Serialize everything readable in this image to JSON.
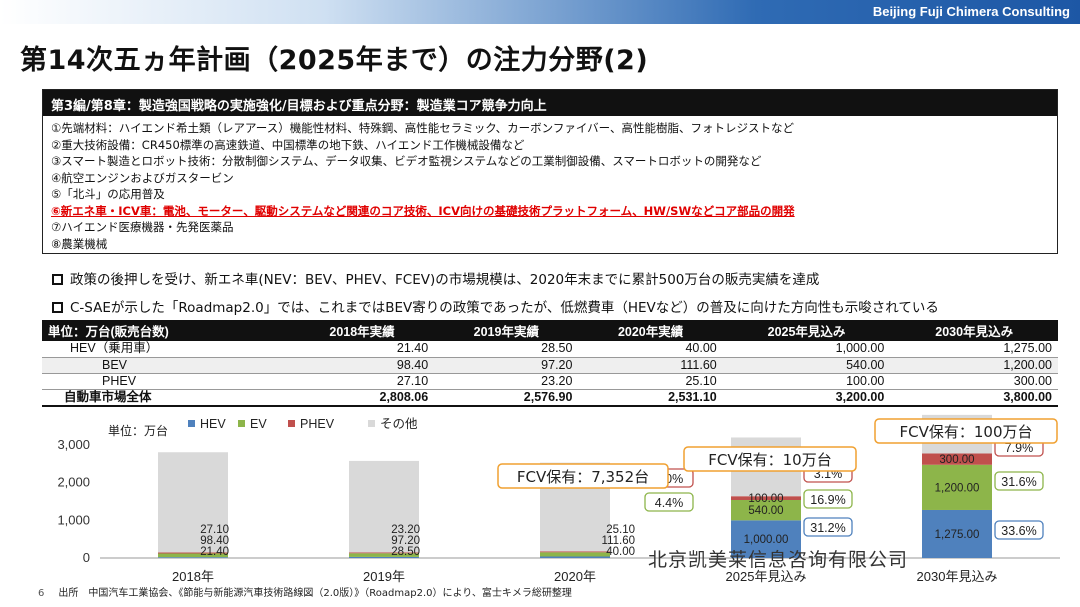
{
  "company": "Beijing Fuji Chimera Consulting",
  "title": "第14次五ヵ年計画（2025年まで）の注力分野(2)",
  "box": {
    "header": "第3編/第8章：製造強国戦略の実施強化/目標および重点分野：製造業コア競争力向上",
    "items": [
      "①先端材料：ハイエンド希土類（レアアース）機能性材料、特殊鋼、高性能セラミック、カーボンファイバー、高性能樹脂、フォトレジストなど",
      "②重大技術設備：CR450標準の高速鉄道、中国標準の地下鉄、ハイエンド工作機械設備など",
      "③スマート製造とロボット技術：分散制御システム、データ収集、ビデオ監視システムなどの工業制御設備、スマートロボットの開発など",
      "④航空エンジンおよびガスタービン",
      "⑤「北斗」の応用普及",
      "⑥新エネ車・ICV車：電池、モーター、駆動システムなど関連のコア技術、ICV向けの基礎技術プラットフォーム、HW/SWなどコア部品の開発",
      "⑦ハイエンド医療機器・先発医薬品",
      "⑧農業機械"
    ],
    "highlight_index": 5
  },
  "bullets": [
    "政策の後押しを受け、新エネ車(NEV：BEV、PHEV、FCEV)の市場規模は、2020年末までに累計500万台の販売実績を達成",
    "C-SAEが示した「Roadmap2.0」では、これまではBEV寄りの政策であったが、低燃費車（HEVなど）の普及に向けた方向性も示唆されている"
  ],
  "table": {
    "headers": [
      "単位：万台(販売台数)",
      "2018年実績",
      "2019年実績",
      "2020年実績",
      "2025年見込み",
      "2030年見込み"
    ],
    "rows": [
      {
        "label": "HEV（乗用車）",
        "values": [
          "21.40",
          "28.50",
          "40.00",
          "1,000.00",
          "1,275.00"
        ]
      },
      {
        "label": "BEV",
        "values": [
          "98.40",
          "97.20",
          "111.60",
          "540.00",
          "1,200.00"
        ]
      },
      {
        "label": "PHEV",
        "values": [
          "27.10",
          "23.20",
          "25.10",
          "100.00",
          "300.00"
        ]
      },
      {
        "label": "自動車市場全体",
        "values": [
          "2,808.06",
          "2,576.90",
          "2,531.10",
          "3,200.00",
          "3,800.00"
        ]
      }
    ]
  },
  "chart_data": {
    "type": "bar",
    "unit_label": "単位：万台",
    "categories": [
      "2018年",
      "2019年",
      "2020年",
      "2025年見込み",
      "2030年見込み"
    ],
    "series": [
      {
        "name": "HEV",
        "color": "#4f81bd",
        "values": [
          21.4,
          28.5,
          40,
          1000,
          1275
        ]
      },
      {
        "name": "EV",
        "color": "#8db54a",
        "values": [
          98.4,
          97.2,
          111.6,
          540,
          1200
        ]
      },
      {
        "name": "PHEV",
        "color": "#c0504d",
        "values": [
          27.1,
          23.2,
          25.1,
          100,
          300
        ]
      },
      {
        "name": "その他",
        "color": "#d9d9d9",
        "values": [
          2661.16,
          2428,
          2354.4,
          1560,
          1025
        ]
      }
    ],
    "data_labels": [
      [
        "21.40",
        "98.40",
        "27.10"
      ],
      [
        "28.50",
        "97.20",
        "23.20"
      ],
      [
        "40.00",
        "111.60",
        "25.10"
      ],
      [
        "1,000.00",
        "540.00",
        "100.00"
      ],
      [
        "1,275.00",
        "1,200.00",
        "300.00"
      ]
    ],
    "yticks": [
      "0",
      "1,000",
      "2,000",
      "3,000"
    ],
    "ylim": [
      0,
      3300
    ],
    "share_labels": [
      null,
      null,
      [
        "",
        "4.4%",
        "1.0%"
      ],
      [
        "31.2%",
        "16.9%",
        "3.1%"
      ],
      [
        "33.6%",
        "31.6%",
        "7.9%"
      ]
    ],
    "fcv_labels": [
      "",
      "",
      "FCV保有：7,352台",
      "FCV保有：10万台",
      "FCV保有：100万台"
    ]
  },
  "footnote": {
    "page": "6",
    "text": "出所　中国汽车工業協会、《節能与新能源汽車技術路線図（2.0版）》（Roadmap2.0）により、富士キメラ総研整理"
  },
  "watermark": "北京凯美莱信息咨询有限公司"
}
